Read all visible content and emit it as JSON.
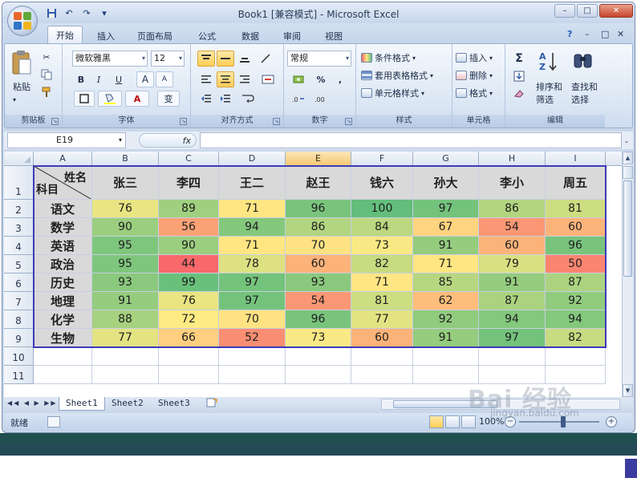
{
  "window": {
    "title": "Book1  [兼容模式] - Microsoft Excel",
    "controls": [
      "–",
      "□",
      "✕"
    ]
  },
  "tabs": [
    "开始",
    "插入",
    "页面布局",
    "公式",
    "数据",
    "审阅",
    "视图"
  ],
  "tabs_right": [
    "?",
    "–",
    "□",
    "✕"
  ],
  "ribbon": {
    "clipboard": {
      "label": "剪贴板",
      "paste": "粘贴"
    },
    "font": {
      "label": "字体",
      "name": "微软雅黑",
      "size": "12",
      "bold": "B",
      "italic": "I",
      "underline": "U",
      "grow": "A",
      "shrink": "A",
      "fontcolor": "A",
      "phonetic": "变"
    },
    "alignment": {
      "label": "对齐方式"
    },
    "number": {
      "label": "数字",
      "format": "常规",
      "percent": "%",
      "comma": ","
    },
    "styles": {
      "label": "样式",
      "conditional": "条件格式",
      "table": "套用表格格式",
      "cell": "单元格样式"
    },
    "cells": {
      "label": "单元格",
      "insert": "插入",
      "delete": "删除",
      "format": "格式"
    },
    "editing": {
      "label": "编辑",
      "sum": "Σ",
      "sort": "排序和",
      "sort2": "筛选",
      "find": "查找和",
      "find2": "选择"
    }
  },
  "formula_bar": {
    "name_box": "E19",
    "fx": "fx",
    "value": ""
  },
  "columns": [
    "A",
    "B",
    "C",
    "D",
    "E",
    "F",
    "G",
    "H",
    "I"
  ],
  "selected_column": "E",
  "rows": [
    "1",
    "2",
    "3",
    "4",
    "5",
    "6",
    "7",
    "8",
    "9",
    "10",
    "11"
  ],
  "table": {
    "corner_top": "姓名",
    "corner_bottom": "科目",
    "students": [
      "张三",
      "李四",
      "王二",
      "赵王",
      "钱六",
      "孙大",
      "李小",
      "周五"
    ],
    "subjects": [
      {
        "name": "语文",
        "scores": [
          76,
          89,
          71,
          96,
          100,
          97,
          86,
          81
        ]
      },
      {
        "name": "数学",
        "scores": [
          90,
          56,
          94,
          86,
          84,
          67,
          54,
          60
        ]
      },
      {
        "name": "英语",
        "scores": [
          95,
          90,
          71,
          70,
          73,
          91,
          60,
          96
        ]
      },
      {
        "name": "政治",
        "scores": [
          95,
          44,
          78,
          60,
          82,
          71,
          79,
          50
        ]
      },
      {
        "name": "历史",
        "scores": [
          93,
          99,
          97,
          93,
          71,
          85,
          91,
          87
        ]
      },
      {
        "name": "地理",
        "scores": [
          91,
          76,
          97,
          54,
          81,
          62,
          87,
          92
        ]
      },
      {
        "name": "化学",
        "scores": [
          88,
          72,
          70,
          96,
          77,
          92,
          94,
          94
        ]
      },
      {
        "name": "生物",
        "scores": [
          77,
          66,
          52,
          73,
          60,
          91,
          97,
          82
        ]
      }
    ]
  },
  "sheets": [
    "Sheet1",
    "Sheet2",
    "Sheet3"
  ],
  "active_sheet": "Sheet1",
  "status": {
    "ready": "就绪",
    "zoom": "100%"
  },
  "watermark": {
    "main": "Bai 经验",
    "sub": "jingyan.baidu.com"
  }
}
